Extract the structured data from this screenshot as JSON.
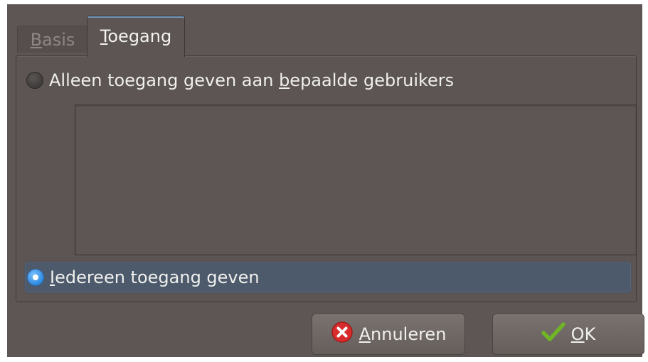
{
  "tabs": [
    {
      "label_ul": "B",
      "label_rest": "asis",
      "active": false
    },
    {
      "label_ul": "T",
      "label_rest": "oegang",
      "active": true
    }
  ],
  "access": {
    "option_specific_pre": "Alleen toegang geven aan ",
    "option_specific_ul": "b",
    "option_specific_post": "epaalde gebruikers",
    "option_everyone_ul": "I",
    "option_everyone_rest": "edereen toegang geven",
    "selected": "everyone"
  },
  "buttons": {
    "cancel_ul": "A",
    "cancel_rest": "nnuleren",
    "ok_ul": "O",
    "ok_rest": "K"
  },
  "colors": {
    "dialog_bg": "#5e5654",
    "selection_bg": "#4d5a6c",
    "radio_on": "#2b8ae0",
    "cancel_icon": "#d92c2c",
    "ok_icon": "#6fb526"
  },
  "icons": {
    "cancel": "cancel-circle-icon",
    "ok": "checkmark-icon"
  }
}
